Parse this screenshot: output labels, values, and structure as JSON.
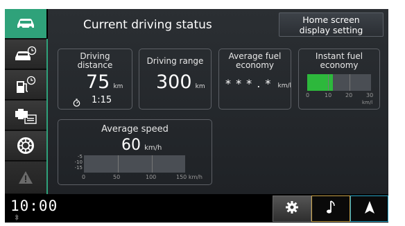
{
  "header": {
    "title": "Current driving status",
    "home_button_line1": "Home screen",
    "home_button_line2": "display setting"
  },
  "sidebar": {
    "items": [
      {
        "icon": "car-icon",
        "state": "active"
      },
      {
        "icon": "car-clock-icon",
        "state": "normal"
      },
      {
        "icon": "fuel-clock-icon",
        "state": "normal"
      },
      {
        "icon": "engine-display-icon",
        "state": "normal"
      },
      {
        "icon": "tire-icon",
        "state": "normal"
      },
      {
        "icon": "warning-icon",
        "state": "disabled"
      }
    ]
  },
  "panels": {
    "driving_distance": {
      "label_line1": "Driving",
      "label_line2": "distance",
      "value": "75",
      "unit": "km",
      "time": "1:15"
    },
    "driving_range": {
      "label": "Driving range",
      "value": "300",
      "unit": "km"
    },
    "avg_fuel": {
      "label_line1": "Average fuel",
      "label_line2": "economy",
      "value": "* * * . *",
      "unit": "km/l"
    },
    "instant_fuel": {
      "label_line1": "Instant fuel",
      "label_line2": "economy",
      "ticks": [
        "0",
        "10",
        "20",
        "30"
      ],
      "unit": "km/l",
      "level_fraction": 0.4
    },
    "avg_speed": {
      "label": "Average speed",
      "value": "60",
      "unit": "km/h",
      "y_ticks": [
        "-5",
        "-10",
        "-15"
      ],
      "x_ticks": [
        "0",
        "50",
        "100",
        "150 km/h"
      ]
    }
  },
  "bottom": {
    "clock": "10:00",
    "bluetooth_icon": "bluetooth-icon",
    "buttons": [
      {
        "icon": "settings-gear-icon"
      },
      {
        "icon": "music-note-icon"
      },
      {
        "icon": "navigation-arrow-icon"
      }
    ]
  },
  "colors": {
    "accent_green": "#2fa27a",
    "fuel_bar_green": "#2db83c",
    "music_border": "#c8a24a",
    "nav_border": "#2aa7c9"
  }
}
